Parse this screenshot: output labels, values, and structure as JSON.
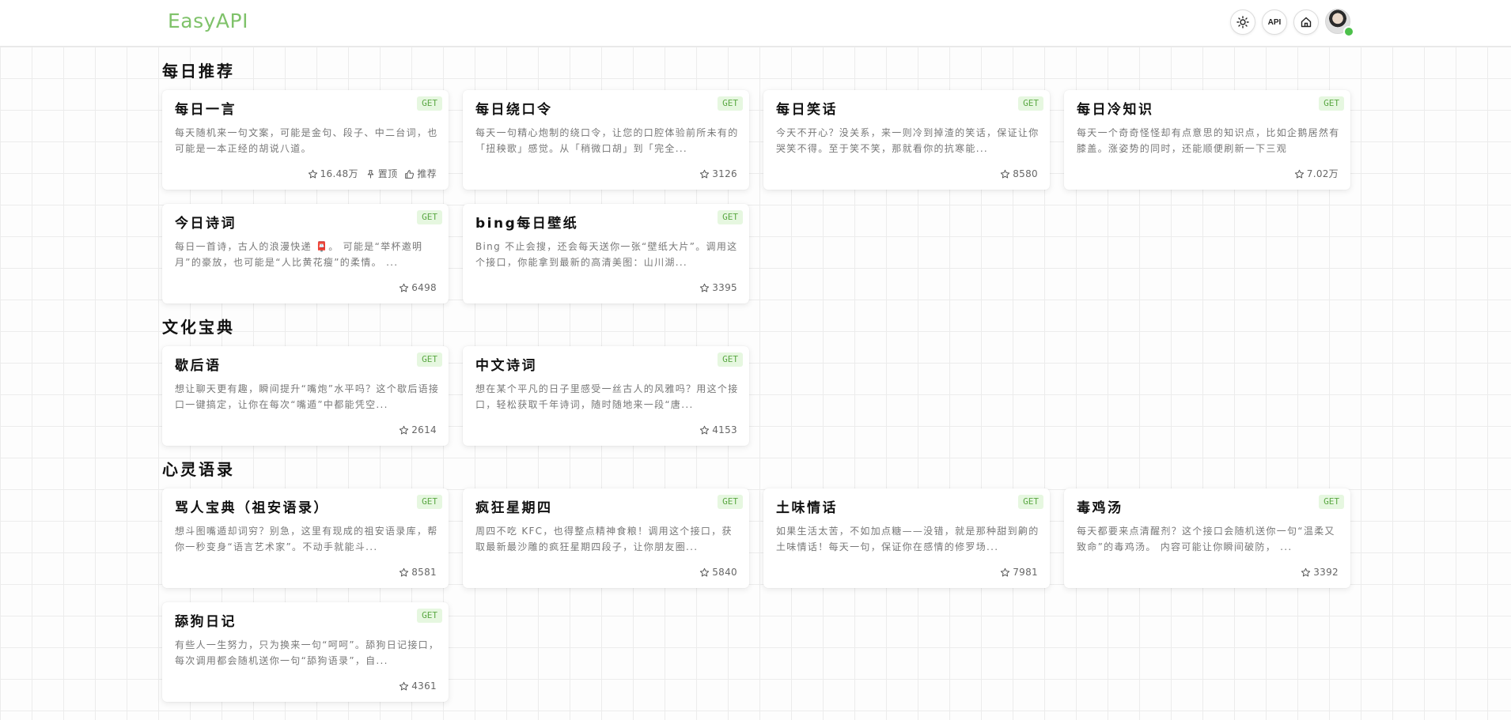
{
  "header": {
    "logo": "EasyAPI",
    "api_label": "API"
  },
  "sections": [
    {
      "title": "每日推荐",
      "cards": [
        {
          "title": "每日一言",
          "method": "GET",
          "desc": "每天随机来一句文案，可能是金句、段子、中二台词，也可能是一本正经的胡说八道。",
          "stars": "16.48万",
          "pin_label": "置顶",
          "recommend_label": "推荐"
        },
        {
          "title": "每日绕口令",
          "method": "GET",
          "desc": "每天一句精心炮制的绕口令，让您的口腔体验前所未有的「扭秧歌」感觉。从「稍微口胡」到「完全...",
          "stars": "3126"
        },
        {
          "title": "每日笑话",
          "method": "GET",
          "desc": "今天不开心？没关系，来一则冷到掉渣的笑话，保证让你哭笑不得。至于笑不笑，那就看你的抗寒能...",
          "stars": "8580"
        },
        {
          "title": "每日冷知识",
          "method": "GET",
          "desc": "每天一个奇奇怪怪却有点意思的知识点，比如企鹅居然有膝盖。涨姿势的同时，还能顺便刷新一下三观",
          "stars": "7.02万"
        },
        {
          "title": "今日诗词",
          "method": "GET",
          "desc": "每日一首诗，古人的浪漫快递 📮。 可能是“举杯邀明月”的豪放，也可能是“人比黄花瘦”的柔情。 ...",
          "stars": "6498"
        },
        {
          "title": "bing每日壁纸",
          "method": "GET",
          "desc": "Bing 不止会搜，还会每天送你一张“壁纸大片”。调用这个接口，你能拿到最新的高清美图：山川湖...",
          "stars": "3395"
        }
      ]
    },
    {
      "title": "文化宝典",
      "cards": [
        {
          "title": "歇后语",
          "method": "GET",
          "desc": "想让聊天更有趣，瞬间提升“嘴炮”水平吗？这个歇后语接口一键搞定，让你在每次“嘴遁”中都能凭空...",
          "stars": "2614"
        },
        {
          "title": "中文诗词",
          "method": "GET",
          "desc": "想在某个平凡的日子里感受一丝古人的风雅吗？用这个接口，轻松获取千年诗词，随时随地来一段“唐...",
          "stars": "4153"
        }
      ]
    },
    {
      "title": "心灵语录",
      "cards": [
        {
          "title": "骂人宝典（祖安语录）",
          "method": "GET",
          "desc": "想斗图嘴遁却词穷？别急，这里有现成的祖安语录库，帮你一秒变身“语言艺术家”。不动手就能斗...",
          "stars": "8581"
        },
        {
          "title": "疯狂星期四",
          "method": "GET",
          "desc": "周四不吃 KFC，也得整点精神食粮！调用这个接口，获取最新最沙雕的疯狂星期四段子，让你朋友圈...",
          "stars": "5840"
        },
        {
          "title": "土味情话",
          "method": "GET",
          "desc": "如果生活太苦，不如加点糖——没错，就是那种甜到齁的土味情话！每天一句，保证你在感情的修罗场...",
          "stars": "7981"
        },
        {
          "title": "毒鸡汤",
          "method": "GET",
          "desc": "每天都要来点清醒剂？这个接口会随机送你一句“温柔又致命”的毒鸡汤。 内容可能让你瞬间破防， ...",
          "stars": "3392"
        },
        {
          "title": "舔狗日记",
          "method": "GET",
          "desc": "有些人一生努力，只为换来一句“呵呵”。舔狗日记接口，每次调用都会随机送你一句“舔狗语录”，自...",
          "stars": "4361"
        }
      ]
    }
  ]
}
